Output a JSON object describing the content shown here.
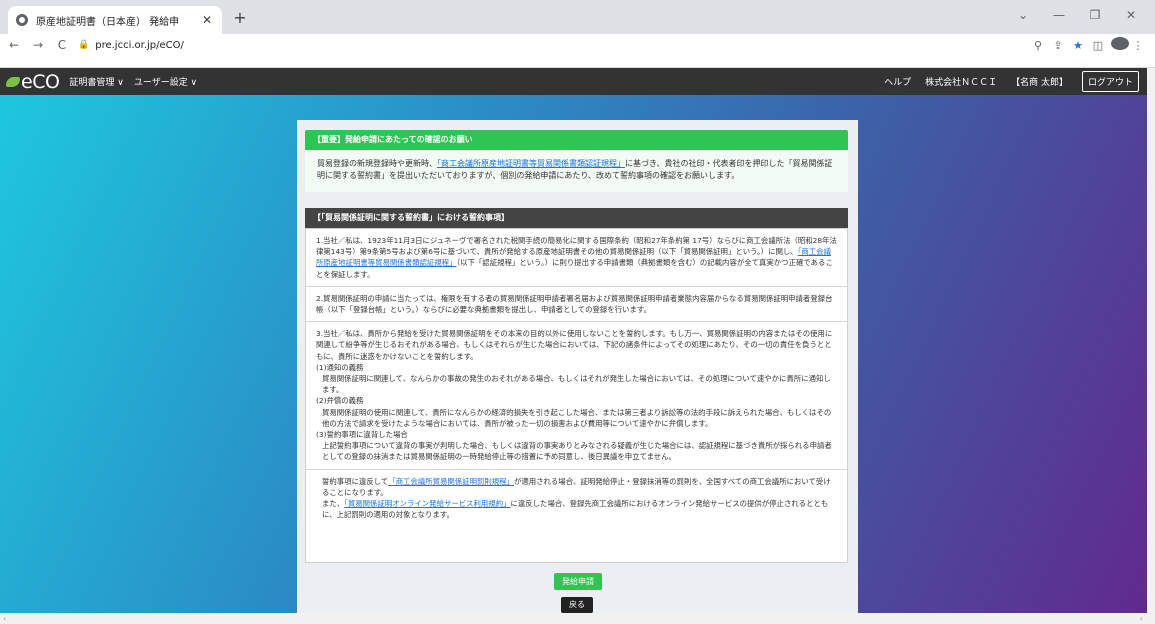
{
  "browser": {
    "tab_title": "原産地証明書（日本産） 発給申",
    "tab_close": "✕",
    "new_tab": "+",
    "url": "pre.jcci.or.jp/eCO/",
    "win_min": "⌄",
    "win_minimize": "—",
    "win_restore": "❐",
    "win_close": "✕",
    "back": "←",
    "forward": "→",
    "reload": "C",
    "lock": "🔒",
    "zoom": "⚲",
    "share": "⇪",
    "star": "★",
    "sidepanel": "◫",
    "menu": "⋮"
  },
  "nav": {
    "logo": "eCO",
    "menu_cert": "証明書管理 ∨",
    "menu_user": "ユーザー設定 ∨",
    "help": "ヘルプ",
    "company": "株式会社ＮＣＣＩ",
    "user": "【名商 太郎】",
    "logout": "ログアウト"
  },
  "notice": {
    "title": "【重要】発給申請にあたっての確認のお願い",
    "text_before": "貿易登録の新規登録時や更新時、",
    "link": "「商工会議所原産地証明書等貿易関係書類認証規程」",
    "text_after": "に基づき、貴社の社印・代表者印を押印した「貿易関係証明に関する誓約書」を提出いただいておりますが、個別の発給申請にあたり、改めて誓約事項の確認をお願いします。"
  },
  "terms": {
    "title": "【「貿易関係証明に関する誓約書」における誓約事項】",
    "p1_a": "1.当社／私は、1923年11月3日にジュネーヴで署名された税関手続の簡易化に関する国際条約（昭和27年条約第 17号）ならびに商工会議所法（昭和28年法律第143号）第9条第5号および第6号に基づいて、貴所が発給する原産地証明書その他の貿易関係証明（以下「貿易関係証明」という。）に関し、",
    "p1_link": "「商工会議所原産地証明書等貿易関係書類認証規程」",
    "p1_b": "（以下「認証規程」という。）に則り提出する申請書類（典拠書類を含む）の記載内容が全て真実かつ正確であることを保証します。",
    "p2": "2.貿易関係証明の申請に当たっては、権限を有する者の貿易関係証明申請者署名届および貿易関係証明申請者業態内容届からなる貿易関係証明申請者登録台帳（以下「登録台帳」という。）ならびに必要な典拠書類を提出し、申請者としての登録を行います。",
    "p3": "3.当社／私は、貴所から発給を受けた貿易関係証明をその本来の目的以外に使用しないことを誓約します。もし万一、貿易関係証明の内容またはその使用に関連して紛争等が生じるおそれがある場合、もしくはそれらが生じた場合においては、下記の諸条件によってその処理にあたり、その一切の責任を負うとともに、貴所に迷惑をかけないことを誓約します。",
    "s1_title": "(1)通知の義務",
    "s1_text": "貿易関係証明に関連して、なんらかの事故の発生のおそれがある場合、もしくはそれが発生した場合においては、その処理について速やかに貴所に通知します。",
    "s2_title": "(2)弁償の義務",
    "s2_text": "貿易関係証明の使用に関連して、貴所になんらかの経済的損失を引き起こした場合、または第三者より訴訟等の法的手段に訴えられた場合、もしくはその他の方法で請求を受けたような場合においては、貴所が被った一切の損害および費用等について速やかに弁償します。",
    "s3_title": "(3)誓約事項に違背した場合",
    "s3_text": "上記誓約事項について違背の事実が判明した場合、もしくは違背の事実ありとみなされる疑義が生じた場合には、認証規程に基づき貴所が採られる申請者としての登録の抹消または貿易関係証明の一時発給停止等の措置に予め同意し、後日異議を申立てません。",
    "p4_a": "誓約事項に違反して",
    "p4_link": "「商工会議所貿易関係証明罰則規程」",
    "p4_b": "が適用される場合、証明発給停止・登録抹消等の罰則を、全国すべての商工会議所において受けることになります。",
    "p5_a": "また、",
    "p5_link": "「貿易関係証明オンライン発給サービス利用規約」",
    "p5_b": "に違反した場合、登録先商工会議所におけるオンライン発給サービスの提供が停止されるとともに、上記罰則の適用の対象となります。"
  },
  "buttons": {
    "apply": "発給申請",
    "back": "戻る"
  },
  "scroll": {
    "left": "‹",
    "right": "›"
  }
}
